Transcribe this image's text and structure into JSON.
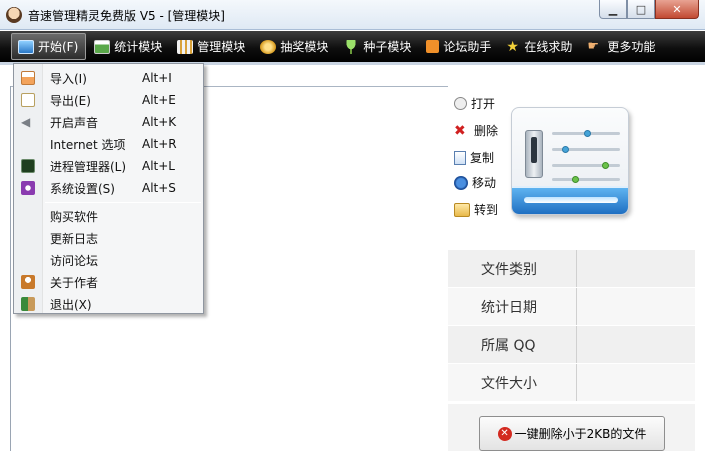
{
  "window": {
    "title": "音速管理精灵免费版 V5 - [管理模块]",
    "controls": [
      "minimize",
      "maximize",
      "close"
    ]
  },
  "toolbar": {
    "items": [
      {
        "label": "开始(F)",
        "icon": "monitor-icon",
        "color": "#4a9be0"
      },
      {
        "label": "统计模块",
        "icon": "chart-window-icon",
        "color": "#5aa84a"
      },
      {
        "label": "管理模块",
        "icon": "manage-grid-icon",
        "color": "#d9a23a"
      },
      {
        "label": "抽奖模块",
        "icon": "prize-icon",
        "color": "#e3b33c"
      },
      {
        "label": "种子模块",
        "icon": "seedling-icon",
        "color": "#7cc24a"
      },
      {
        "label": "论坛助手",
        "icon": "rss-icon",
        "color": "#f0902a"
      },
      {
        "label": "在线求助",
        "icon": "star-icon",
        "color": "#f2d13a"
      },
      {
        "label": "更多功能",
        "icon": "hand-pointer-icon",
        "color": "#f0b070"
      }
    ]
  },
  "menu": {
    "items": [
      {
        "label": "导入(I)",
        "shortcut": "Alt+I",
        "icon": "import-icon",
        "color": "#f3a35b"
      },
      {
        "label": "导出(E)",
        "shortcut": "Alt+E",
        "icon": "export-icon",
        "color": "#dfc889"
      },
      {
        "label": "开启声音",
        "shortcut": "Alt+K",
        "icon": "speaker-icon",
        "color": "#8a8f96"
      },
      {
        "label": "Internet 选项",
        "shortcut": "Alt+R",
        "icon": "",
        "color": ""
      },
      {
        "label": "进程管理器(L)",
        "shortcut": "Alt+L",
        "icon": "task-manager-icon",
        "color": "#2f6b2f"
      },
      {
        "label": "系统设置(S)",
        "shortcut": "Alt+S",
        "icon": "settings-icon",
        "color": "#8a3bb0"
      },
      {
        "label": "购买软件",
        "shortcut": "",
        "icon": "",
        "color": ""
      },
      {
        "label": "更新日志",
        "shortcut": "",
        "icon": "",
        "color": ""
      },
      {
        "label": "访问论坛",
        "shortcut": "",
        "icon": "",
        "color": ""
      },
      {
        "label": "关于作者",
        "shortcut": "",
        "icon": "author-icon",
        "color": "#c8792b"
      },
      {
        "label": "退出(X)",
        "shortcut": "",
        "icon": "exit-icon",
        "color": "#3a8a3a"
      }
    ]
  },
  "right_panel": {
    "actions": [
      {
        "label": "打开",
        "icon": "open-icon"
      },
      {
        "label": "删除",
        "icon": "delete-x-icon"
      },
      {
        "label": "复制",
        "icon": "copy-icon"
      },
      {
        "label": "移动",
        "icon": "move-icon"
      },
      {
        "label": "转到",
        "icon": "folder-icon"
      }
    ],
    "properties": [
      {
        "label": "文件类别",
        "value": ""
      },
      {
        "label": "统计日期",
        "value": ""
      },
      {
        "label": "所属 QQ",
        "value": ""
      },
      {
        "label": "文件大小",
        "value": ""
      }
    ],
    "delete_button": "一键删除小于2KB的文件"
  }
}
